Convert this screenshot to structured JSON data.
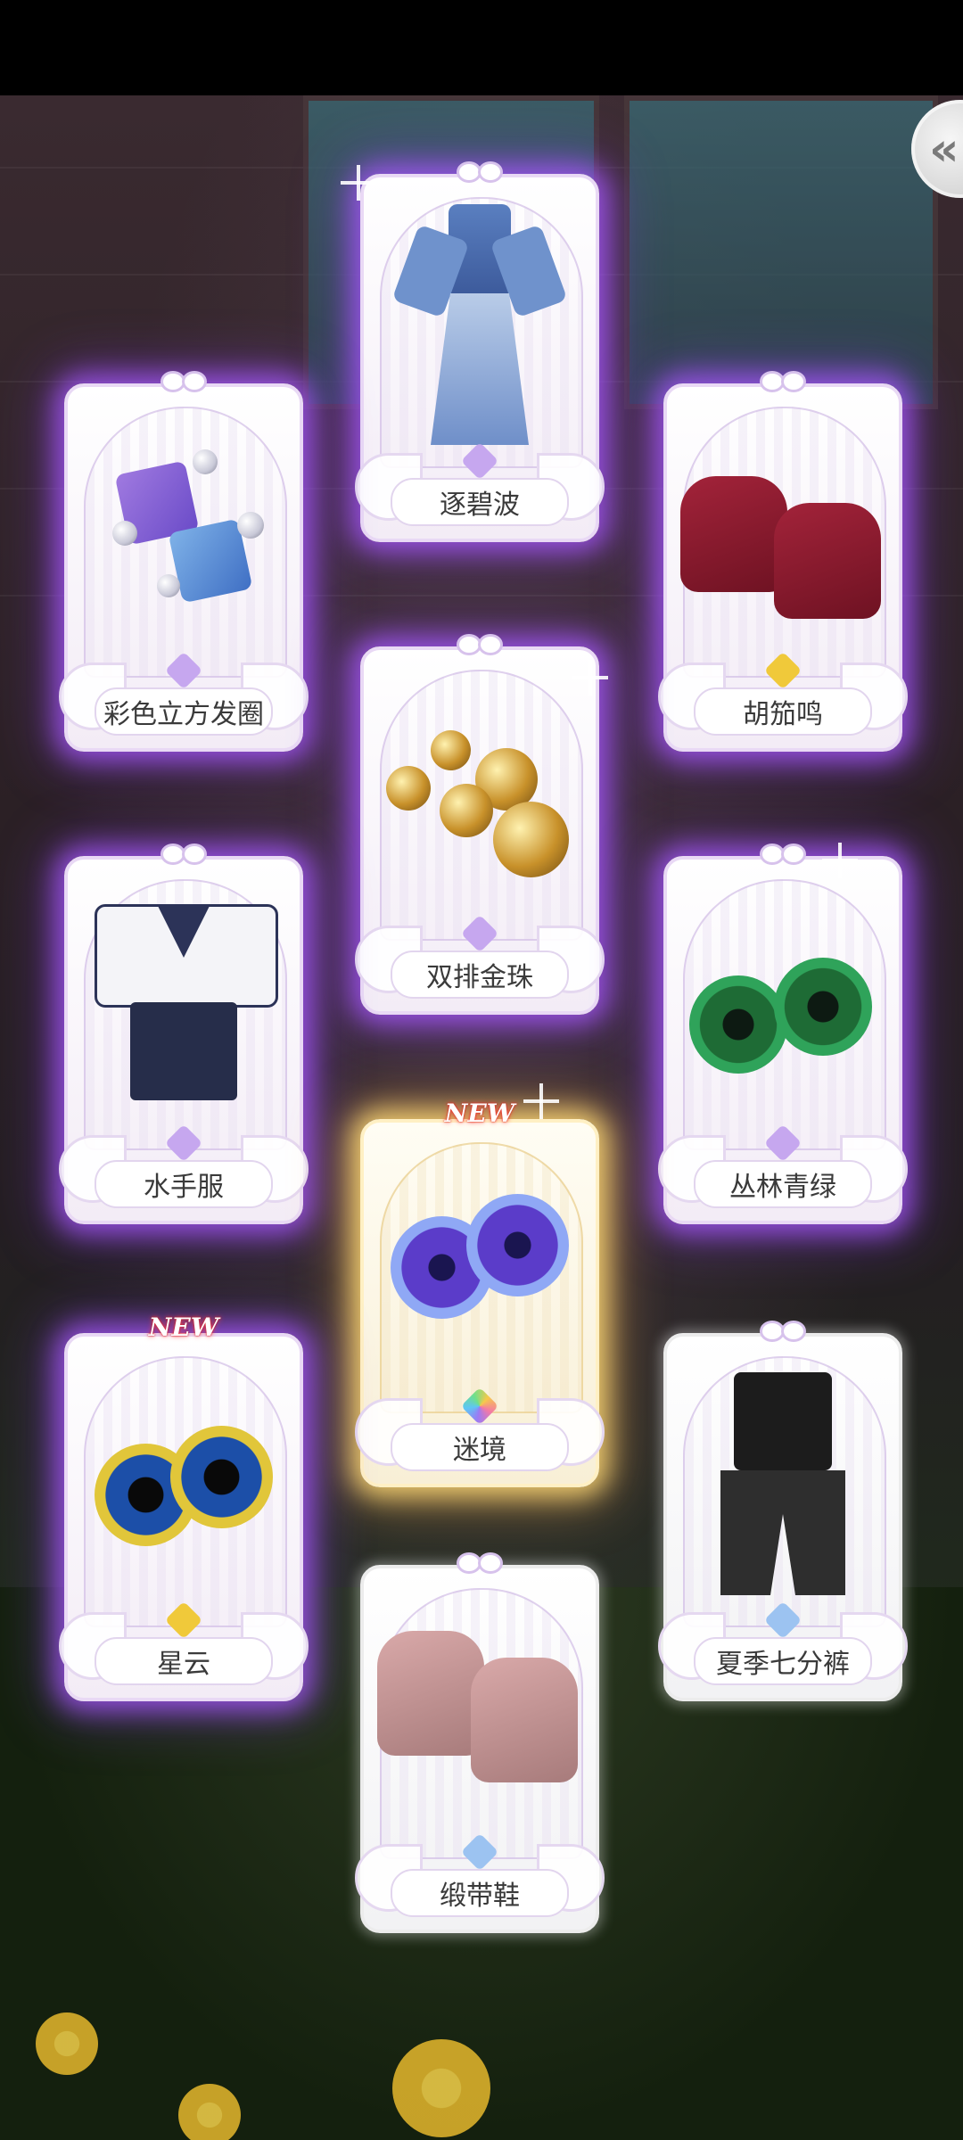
{
  "items": [
    {
      "name": "逐碧波",
      "rarity_star": "purple"
    },
    {
      "name": "彩色立方发圈",
      "rarity_star": "purple"
    },
    {
      "name": "胡笳鸣",
      "rarity_star": "gold"
    },
    {
      "name": "双排金珠",
      "rarity_star": "purple"
    },
    {
      "name": "水手服",
      "rarity_star": "purple"
    },
    {
      "name": "丛林青绿",
      "rarity_star": "purple"
    },
    {
      "name": "迷境",
      "rarity_star": "rainbow",
      "badge": "NEW"
    },
    {
      "name": "星云",
      "rarity_star": "gold",
      "badge": "NEW"
    },
    {
      "name": "夏季七分裤",
      "rarity_star": "blue"
    },
    {
      "name": "缎带鞋",
      "rarity_star": "blue"
    }
  ],
  "back_button": {
    "icon": "double-chevron-left-icon"
  },
  "colors": {
    "glow_purple": "#aa5aff",
    "glow_gold": "#ffdc78",
    "star_purple": "#c6a7ef",
    "star_gold": "#f0c93a",
    "star_blue": "#9cc3f1"
  }
}
